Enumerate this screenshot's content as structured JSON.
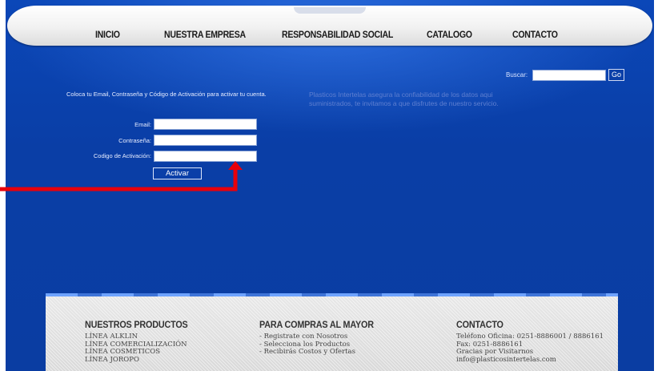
{
  "nav": {
    "items": [
      "INICIO",
      "NUESTRA EMPRESA",
      "RESPONSABILIDAD SOCIAL",
      "CATALOGO",
      "CONTACTO"
    ]
  },
  "search": {
    "label": "Buscar:",
    "button": "Go"
  },
  "activation": {
    "intro": "Coloca tu Email, Contraseña y Código de Activación para activar tu cuenta.",
    "email_label": "Email:",
    "password_label": "Contraseña:",
    "code_label": "Codigo de Activación:",
    "submit": "Activar"
  },
  "notice": "Plasticos Intertelas asegura la confiabilidad de los datos aqui suministrados, te invitamos a que disfrutes de nuestro servicio.",
  "footer": {
    "products": {
      "title": "NUESTROS PRODUCTOS",
      "items": [
        "LÍNEA ALKLIN",
        "LÍNEA COMERCIALIZACIÓN",
        "LÍNEA COSMETICOS",
        "LÍNEA JOROPO"
      ]
    },
    "wholesale": {
      "title": "PARA COMPRAS AL MAYOR",
      "items": [
        "- Registrate con Nosotros",
        "- Selecciona los Productos",
        "- Recibirás Costos y Ofertas"
      ]
    },
    "contact": {
      "title": "CONTACTO",
      "items": [
        "Teléfono Oficina: 0251-8886001 / 8886161",
        "Fax: 0251-8886161",
        "Gracias por Visitarnos",
        "info@plasticosintertelas.com"
      ]
    }
  },
  "colors": {
    "background": "#0a3fa8",
    "annotation_arrow": "#e8000b"
  }
}
